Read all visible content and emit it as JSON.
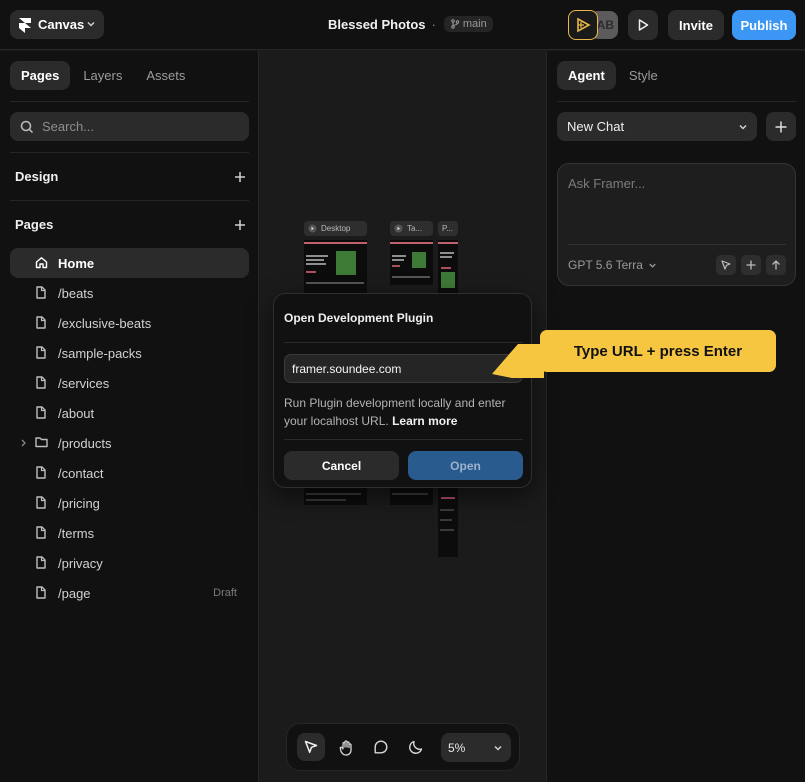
{
  "topbar": {
    "project_label": "Canvas",
    "doc_title": "Blessed Photos",
    "separator": "·",
    "branch_name": "main",
    "avatar_initials": "AB",
    "invite_label": "Invite",
    "publish_label": "Publish"
  },
  "left": {
    "tabs": [
      {
        "label": "Pages",
        "active": true
      },
      {
        "label": "Layers",
        "active": false
      },
      {
        "label": "Assets",
        "active": false
      }
    ],
    "search_placeholder": "Search...",
    "design_heading": "Design",
    "pages_heading": "Pages",
    "pages": [
      {
        "label": "Home",
        "icon": "home-icon",
        "active": true
      },
      {
        "label": "/beats",
        "icon": "page-icon"
      },
      {
        "label": "/exclusive-beats",
        "icon": "page-icon"
      },
      {
        "label": "/sample-packs",
        "icon": "page-icon"
      },
      {
        "label": "/services",
        "icon": "page-icon"
      },
      {
        "label": "/about",
        "icon": "page-icon"
      },
      {
        "label": "/products",
        "icon": "folder-icon",
        "expandable": true
      },
      {
        "label": "/contact",
        "icon": "page-icon"
      },
      {
        "label": "/pricing",
        "icon": "page-icon"
      },
      {
        "label": "/terms",
        "icon": "page-icon"
      },
      {
        "label": "/privacy",
        "icon": "page-icon"
      },
      {
        "label": "/page",
        "icon": "page-icon",
        "badge": "Draft"
      }
    ]
  },
  "canvas": {
    "frames": [
      {
        "label": "Desktop"
      },
      {
        "label": "Ta..."
      },
      {
        "label": "P..."
      }
    ],
    "zoom_level": "5%"
  },
  "modal": {
    "title": "Open Development Plugin",
    "url_value": "framer.soundee.com",
    "description": "Run Plugin development locally and enter your localhost URL.",
    "learn_more": "Learn more",
    "cancel_label": "Cancel",
    "open_label": "Open"
  },
  "callout": {
    "text": "Type URL + press Enter"
  },
  "right": {
    "tabs": [
      {
        "label": "Agent",
        "active": true
      },
      {
        "label": "Style",
        "active": false
      }
    ],
    "chat_select": "New Chat",
    "ask_placeholder": "Ask Framer...",
    "model": "GPT 5.6 Terra"
  },
  "colors": {
    "accent_blue": "#3b96f4",
    "callout_yellow": "#f7c641",
    "panel_bg": "#111111",
    "canvas_bg": "#1b1b1b"
  }
}
